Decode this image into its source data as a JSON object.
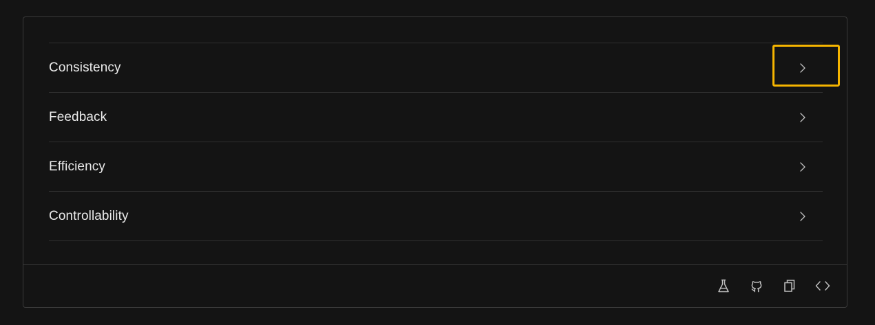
{
  "collapse": {
    "items": [
      {
        "label": "Consistency",
        "arrow_icon": "chevron-right-icon",
        "highlighted": true
      },
      {
        "label": "Feedback",
        "arrow_icon": "chevron-right-icon"
      },
      {
        "label": "Efficiency",
        "arrow_icon": "chevron-right-icon"
      },
      {
        "label": "Controllability",
        "arrow_icon": "chevron-right-icon"
      }
    ]
  },
  "footer": {
    "actions": [
      {
        "icon": "beaker-icon"
      },
      {
        "icon": "github-icon"
      },
      {
        "icon": "copy-icon"
      },
      {
        "icon": "code-icon"
      }
    ]
  },
  "colors": {
    "background": "#141414",
    "border": "#3a3a3a",
    "divider": "#303030",
    "text": "#ebebeb",
    "icon": "#bfbfbf",
    "highlight": "#f6b500"
  }
}
